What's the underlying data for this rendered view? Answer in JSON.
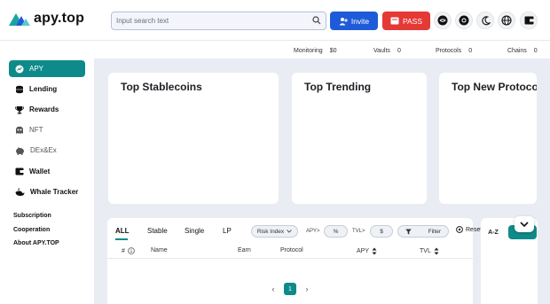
{
  "app": {
    "name": "apy.top"
  },
  "search": {
    "placeholder": "Input search text",
    "value": ""
  },
  "header": {
    "invite_label": "Invite",
    "pass_label": "PASS"
  },
  "stats": [
    {
      "label": "Monitoring",
      "value": "$0"
    },
    {
      "label": "Vaults",
      "value": "0"
    },
    {
      "label": "Protocols",
      "value": "0"
    },
    {
      "label": "Chains",
      "value": "0"
    }
  ],
  "sidebar": {
    "items": [
      {
        "label": "APY",
        "icon": "apy-icon"
      },
      {
        "label": "Lending",
        "icon": "lending-icon"
      },
      {
        "label": "Rewards",
        "icon": "trophy-icon"
      },
      {
        "label": "NFT",
        "icon": "nft-icon"
      },
      {
        "label": "DEx&Ex",
        "icon": "piggy-bank-icon"
      },
      {
        "label": "Wallet",
        "icon": "wallet-icon"
      },
      {
        "label": "Whale Tracker",
        "icon": "whale-icon"
      }
    ],
    "links": [
      "Subscription",
      "Cooperation",
      "About APY.TOP"
    ]
  },
  "cards": [
    {
      "title": "Top Stablecoins"
    },
    {
      "title": "Top Trending"
    },
    {
      "title": "Top New Protocols"
    }
  ],
  "filters": {
    "tabs": [
      "ALL",
      "Stable",
      "Single",
      "LP"
    ],
    "active_tab": "ALL",
    "risk_index": "Risk Index",
    "apy_label": "APY>",
    "apy_unit": "%",
    "tvl_label": "TVL>",
    "tvl_unit": "$",
    "filter_label": "Filter",
    "reset_label": "Reset",
    "sort_label": "A-Z"
  },
  "table": {
    "columns": [
      "#",
      "Name",
      "Earn",
      "Protocol",
      "APY",
      "TVL"
    ]
  },
  "pagination": {
    "current": "1"
  },
  "colors": {
    "accent": "#0f8a8a",
    "invite": "#1f5bd9",
    "pass": "#e53935",
    "background": "#e9edf3"
  }
}
